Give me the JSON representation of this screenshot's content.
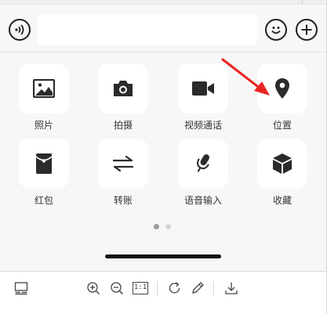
{
  "input_bar": {
    "voice_icon": "voice-wave-icon",
    "text_value": "",
    "emoji_icon": "smiley-icon",
    "plus_icon": "plus-icon"
  },
  "panel": {
    "items": [
      {
        "label": "照片",
        "icon": "photo-icon"
      },
      {
        "label": "拍摄",
        "icon": "camera-icon"
      },
      {
        "label": "视频通话",
        "icon": "video-call-icon"
      },
      {
        "label": "位置",
        "icon": "location-pin-icon"
      },
      {
        "label": "红包",
        "icon": "red-envelope-icon"
      },
      {
        "label": "转账",
        "icon": "transfer-arrows-icon"
      },
      {
        "label": "语音输入",
        "icon": "microphone-icon"
      },
      {
        "label": "收藏",
        "icon": "favorites-cube-icon"
      }
    ],
    "page_count": 2,
    "current_page": 1
  },
  "toolbar": {
    "fit_label": "1:1"
  },
  "colors": {
    "background": "#f7f7f7",
    "tile": "#ffffff",
    "icon": "#2b2b2b",
    "annotation_arrow": "#e8241f"
  }
}
